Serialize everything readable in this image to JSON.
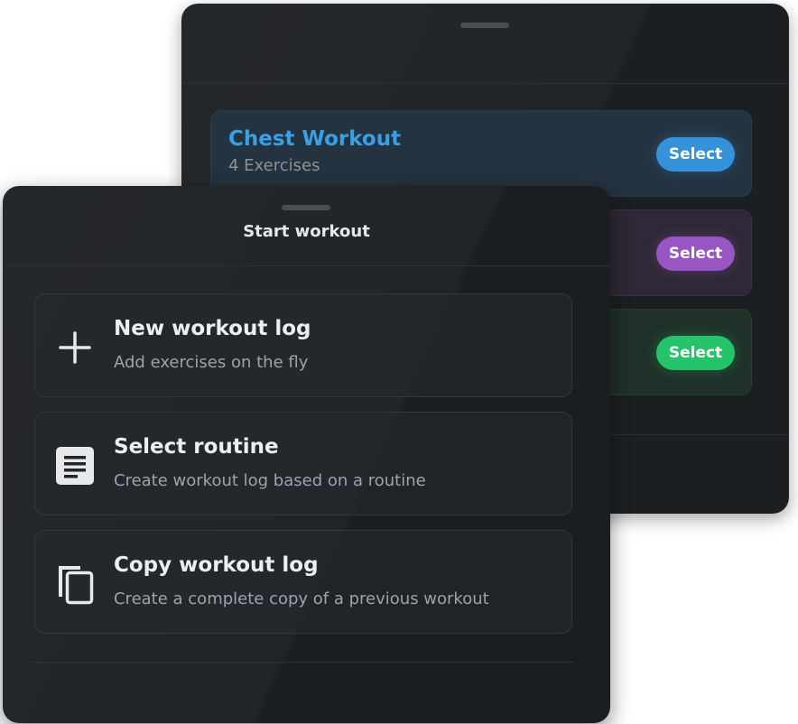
{
  "colors": {
    "sheet_background": "#222528",
    "blue_accent": "#3592d8",
    "purple_accent": "#9a55c4",
    "green_accent": "#26c46a"
  },
  "routines_sheet": {
    "cards": [
      {
        "title": "Chest Workout",
        "subtitle": "4 Exercises",
        "button_label": "Select",
        "accent": "blue"
      },
      {
        "title": "",
        "subtitle": "",
        "button_label": "Select",
        "accent": "purple"
      },
      {
        "title": "",
        "subtitle": "",
        "button_label": "Select",
        "accent": "green"
      }
    ]
  },
  "start_workout_sheet": {
    "title": "Start workout",
    "options": [
      {
        "icon": "plus-icon",
        "title": "New workout log",
        "subtitle": "Add exercises on the fly"
      },
      {
        "icon": "document-icon",
        "title": "Select routine",
        "subtitle": "Create workout log based on a routine"
      },
      {
        "icon": "copy-icon",
        "title": "Copy workout log",
        "subtitle": "Create a complete copy of a previous workout"
      }
    ]
  }
}
